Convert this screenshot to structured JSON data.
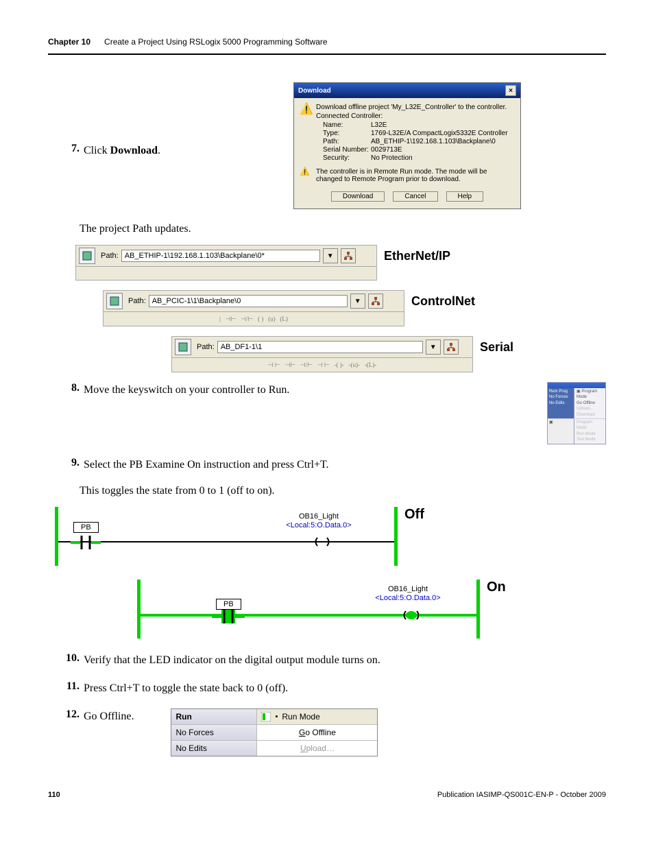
{
  "header": {
    "chapter": "Chapter 10",
    "title": "Create a Project Using RSLogix 5000 Programming Software"
  },
  "steps": {
    "s7": {
      "num": "7.",
      "pre": "Click ",
      "bold": "Download",
      "post": "."
    },
    "pathUpdates": "The project Path updates.",
    "s8": {
      "num": "8.",
      "text": "Move the keyswitch on your controller to Run."
    },
    "s9": {
      "num": "9.",
      "text": "Select the PB Examine On instruction and press Ctrl+T."
    },
    "toggleNote": "This toggles the state from 0 to 1 (off to on).",
    "s10": {
      "num": "10.",
      "text": "Verify that the LED indicator on the digital output module turns on."
    },
    "s11": {
      "num": "11.",
      "text": "Press Ctrl+T to toggle the state back to 0 (off)."
    },
    "s12": {
      "num": "12.",
      "text": "Go Offline."
    }
  },
  "dlg": {
    "title": "Download",
    "close": "×",
    "msg": "Download offline project 'My_L32E_Controller' to the controller.",
    "connected": "Connected Controller:",
    "info": {
      "name_l": "Name:",
      "name_v": "L32E",
      "type_l": "Type:",
      "type_v": "1769-L32E/A CompactLogix5332E Controller",
      "path_l": "Path:",
      "path_v": "AB_ETHIP-1\\192.168.1.103\\Backplane\\0",
      "sn_l": "Serial Number:",
      "sn_v": "0029713E",
      "sec_l": "Security:",
      "sec_v": "No Protection"
    },
    "warn2": "The controller is in Remote Run mode. The mode will be changed to Remote Program prior to download.",
    "btns": {
      "download": "Download",
      "cancel": "Cancel",
      "help": "Help"
    }
  },
  "paths": {
    "labelPath": "Path:",
    "ethip": {
      "value": "AB_ETHIP-1\\192.168.1.103\\Backplane\\0*",
      "label": "EtherNet/IP"
    },
    "cnet": {
      "value": "AB_PCIC-1\\1\\Backplane\\0",
      "label": "ControlNet"
    },
    "serial": {
      "value": "AB_DF1-1\\1",
      "label": "Serial"
    }
  },
  "panel8": {
    "left": [
      "Rem Prog",
      "No Forces",
      "No Edits"
    ],
    "right": [
      "Go Offline",
      "Upload...",
      "Download"
    ],
    "checkbox_label": "Program Mode",
    "bottom": [
      "Program Mode",
      "Run Mode",
      "Test Mode"
    ]
  },
  "rung": {
    "pb": "PB",
    "tagname": "OB16_Light",
    "alias": "<Local:5:O.Data.0>",
    "offLabel": "Off",
    "onLabel": "On"
  },
  "offline": {
    "run": "Run",
    "runmode": "Run Mode",
    "noforces": "No Forces",
    "noedits": "No Edits",
    "gooffline": "Go Offline",
    "upload": "Upload…"
  },
  "footer": {
    "page": "110",
    "pub": "Publication IASIMP-QS001C-EN-P - October 2009"
  }
}
